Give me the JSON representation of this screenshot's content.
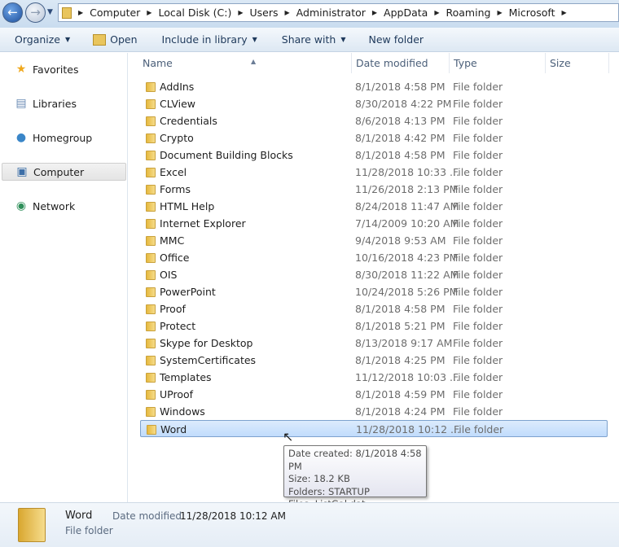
{
  "address": {
    "crumbs": [
      "Computer",
      "Local Disk (C:)",
      "Users",
      "Administrator",
      "AppData",
      "Roaming",
      "Microsoft"
    ]
  },
  "toolbar": {
    "organize": "Organize",
    "open": "Open",
    "include": "Include in library",
    "share": "Share with",
    "new_folder": "New folder"
  },
  "sidebar": {
    "items": [
      {
        "label": "Favorites",
        "icon": "star-icon"
      },
      {
        "label": "Libraries",
        "icon": "libraries-icon"
      },
      {
        "label": "Homegroup",
        "icon": "homegroup-icon"
      },
      {
        "label": "Computer",
        "icon": "computer-icon",
        "selected": true
      },
      {
        "label": "Network",
        "icon": "network-icon"
      }
    ]
  },
  "columns": {
    "name": "Name",
    "date": "Date modified",
    "type": "Type",
    "size": "Size"
  },
  "rows": [
    {
      "name": "AddIns",
      "date": "8/1/2018 4:58 PM",
      "type": "File folder"
    },
    {
      "name": "CLView",
      "date": "8/30/2018 4:22 PM",
      "type": "File folder"
    },
    {
      "name": "Credentials",
      "date": "8/6/2018 4:13 PM",
      "type": "File folder"
    },
    {
      "name": "Crypto",
      "date": "8/1/2018 4:42 PM",
      "type": "File folder"
    },
    {
      "name": "Document Building Blocks",
      "date": "8/1/2018 4:58 PM",
      "type": "File folder"
    },
    {
      "name": "Excel",
      "date": "11/28/2018 10:33 ...",
      "type": "File folder"
    },
    {
      "name": "Forms",
      "date": "11/26/2018 2:13 PM",
      "type": "File folder"
    },
    {
      "name": "HTML Help",
      "date": "8/24/2018 11:47 AM",
      "type": "File folder"
    },
    {
      "name": "Internet Explorer",
      "date": "7/14/2009 10:20 AM",
      "type": "File folder"
    },
    {
      "name": "MMC",
      "date": "9/4/2018 9:53 AM",
      "type": "File folder"
    },
    {
      "name": "Office",
      "date": "10/16/2018 4:23 PM",
      "type": "File folder"
    },
    {
      "name": "OIS",
      "date": "8/30/2018 11:22 AM",
      "type": "File folder"
    },
    {
      "name": "PowerPoint",
      "date": "10/24/2018 5:26 PM",
      "type": "File folder"
    },
    {
      "name": "Proof",
      "date": "8/1/2018 4:58 PM",
      "type": "File folder"
    },
    {
      "name": "Protect",
      "date": "8/1/2018 5:21 PM",
      "type": "File folder"
    },
    {
      "name": "Skype for Desktop",
      "date": "8/13/2018 9:17 AM",
      "type": "File folder"
    },
    {
      "name": "SystemCertificates",
      "date": "8/1/2018 4:25 PM",
      "type": "File folder"
    },
    {
      "name": "Templates",
      "date": "11/12/2018 10:03 ...",
      "type": "File folder"
    },
    {
      "name": "UProof",
      "date": "8/1/2018 4:59 PM",
      "type": "File folder"
    },
    {
      "name": "Windows",
      "date": "8/1/2018 4:24 PM",
      "type": "File folder"
    },
    {
      "name": "Word",
      "date": "11/28/2018 10:12 ...",
      "type": "File folder",
      "selected": true
    }
  ],
  "tooltip": {
    "lines": [
      "Date created: 8/1/2018 4:58 PM",
      "Size: 18.2 KB",
      "Folders: STARTUP",
      "Files: ListGal.dat"
    ]
  },
  "details": {
    "name": "Word",
    "date_label": "Date modified:",
    "date_value": "11/28/2018 10:12 AM",
    "type": "File folder"
  }
}
